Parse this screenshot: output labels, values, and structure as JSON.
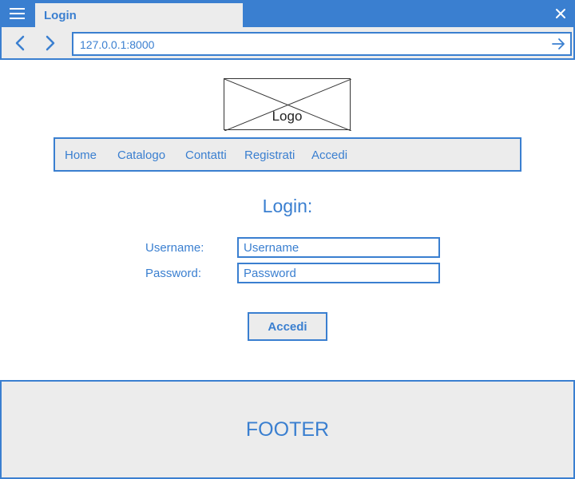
{
  "colors": {
    "accent": "#3a7fd0",
    "panel": "#ececec",
    "background": "#ffffff"
  },
  "window": {
    "tab_title": "Login",
    "menu_icon": "hamburger-icon",
    "close_icon": "close-icon"
  },
  "browser": {
    "back_icon": "chevron-left-icon",
    "forward_icon": "chevron-right-icon",
    "url": "127.0.0.1:8000",
    "go_icon": "arrow-right-icon"
  },
  "logo": {
    "label": "Logo",
    "placeholder_icon": "image-placeholder-icon"
  },
  "nav": {
    "items": [
      "Home",
      "Catalogo",
      "Contatti",
      "Registrati",
      "Accedi"
    ]
  },
  "login": {
    "heading": "Login:",
    "username_label": "Username:",
    "username_placeholder": "Username",
    "password_label": "Password:",
    "password_placeholder": "Password",
    "submit_label": "Accedi"
  },
  "footer": {
    "text": "FOOTER"
  }
}
